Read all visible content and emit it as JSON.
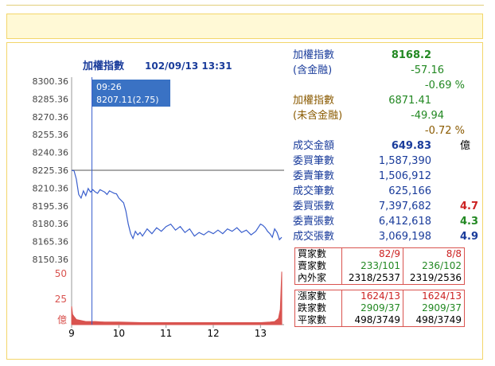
{
  "chart_header": {
    "title": "加權指數",
    "datetime": "102/09/13 13:31"
  },
  "tooltip": {
    "time": "09:26",
    "value": "8207.11(2.75)"
  },
  "colors": {
    "line": "#3a5fcd",
    "volume": "#d9534f",
    "reference": "#aaaaaa",
    "up": "#cc2222",
    "down": "#228822",
    "blue_text": "#1a3c9b",
    "brown_text": "#8a5a00",
    "frame": "#f3d66a"
  },
  "chart_data": {
    "type": "line",
    "x_ticks": [
      "9",
      "10",
      "11",
      "12",
      "13"
    ],
    "y_ticks": [
      "8300.36",
      "8285.36",
      "8270.36",
      "8255.36",
      "8240.36",
      "8225.36",
      "8210.36",
      "8195.36",
      "8180.36",
      "8165.36",
      "8150.36"
    ],
    "ylim": [
      8150.36,
      8300.36
    ],
    "reference_value": 8225.36,
    "tooltip_x": 9.43,
    "series": [
      {
        "x": [
          9.0,
          9.05,
          9.1,
          9.15,
          9.2,
          9.25,
          9.3,
          9.35,
          9.4,
          9.45,
          9.5,
          9.55,
          9.6,
          9.65,
          9.7,
          9.75,
          9.8,
          9.85,
          9.9,
          9.95,
          10.0,
          10.05,
          10.1,
          10.15,
          10.2,
          10.25,
          10.3,
          10.35,
          10.4,
          10.45,
          10.5,
          10.6,
          10.7,
          10.8,
          10.9,
          11.0,
          11.1,
          11.2,
          11.3,
          11.4,
          11.5,
          11.6,
          11.7,
          11.8,
          11.9,
          12.0,
          12.1,
          12.2,
          12.3,
          12.4,
          12.5,
          12.6,
          12.7,
          12.8,
          12.9,
          13.0,
          13.05,
          13.1,
          13.15,
          13.2,
          13.25,
          13.3,
          13.35,
          13.4,
          13.45
        ],
        "values": [
          8225.2,
          8225.0,
          8218.0,
          8205.0,
          8202.0,
          8208.0,
          8204.0,
          8210.0,
          8207.0,
          8209.0,
          8207.1,
          8206.0,
          8209.0,
          8208.0,
          8207.0,
          8205.0,
          8208.0,
          8207.0,
          8206.0,
          8205.5,
          8202.0,
          8200.0,
          8198.0,
          8191.0,
          8180.0,
          8172.0,
          8168.0,
          8174.0,
          8171.0,
          8173.0,
          8170.0,
          8176.0,
          8172.0,
          8177.0,
          8174.0,
          8178.0,
          8180.0,
          8175.0,
          8178.0,
          8173.0,
          8176.0,
          8170.0,
          8173.0,
          8171.0,
          8174.0,
          8172.0,
          8175.0,
          8172.0,
          8176.0,
          8174.0,
          8177.0,
          8173.0,
          8175.0,
          8171.0,
          8174.0,
          8180.0,
          8179.0,
          8177.0,
          8174.0,
          8172.0,
          8169.0,
          8176.0,
          8173.0,
          8167.0,
          8169.0
        ]
      }
    ],
    "volume": {
      "y_ticks": [
        "50",
        "25",
        "億"
      ],
      "ylim": [
        0,
        50
      ],
      "x": [
        9.0,
        9.02,
        9.05,
        9.1,
        9.2,
        9.3,
        9.5,
        9.7,
        10.0,
        10.5,
        11.0,
        11.5,
        12.0,
        12.5,
        13.0,
        13.2,
        13.3,
        13.38,
        13.42,
        13.45
      ],
      "values": [
        18,
        10,
        8,
        5,
        4,
        3,
        3,
        2.5,
        2.5,
        2,
        2,
        2,
        2,
        2,
        2,
        2.5,
        3,
        6,
        15,
        52
      ]
    }
  },
  "stats": [
    {
      "label": "加權指數",
      "value": "8168.2",
      "label_color": "#1a3c9b",
      "value_color": "#228822",
      "bold": true
    },
    {
      "label": "(含金融)",
      "value": "-57.16",
      "label_color": "#1a3c9b",
      "value_color": "#228822"
    },
    {
      "label": "",
      "value": "-0.69 %",
      "label_color": "#1a3c9b",
      "value_color": "#228822"
    },
    {
      "label": "加權指數",
      "value": "6871.41",
      "label_color": "#8a5a00",
      "value_color": "#228822"
    },
    {
      "label": "(未含金融)",
      "value": "-49.94",
      "label_color": "#8a5a00",
      "value_color": "#228822"
    },
    {
      "label": "",
      "value": "-0.72 %",
      "label_color": "#8a5a00",
      "value_color": "#8a5a00"
    },
    {
      "label": "成交金額",
      "value": "649.83",
      "unit": "億",
      "label_color": "#1a3c9b",
      "value_color": "#1a3c9b",
      "bold": true
    },
    {
      "label": "委買筆數",
      "value": "1,587,390",
      "label_color": "#1a3c9b",
      "value_color": "#1a3c9b"
    },
    {
      "label": "委賣筆數",
      "value": "1,506,912",
      "label_color": "#1a3c9b",
      "value_color": "#1a3c9b"
    },
    {
      "label": "成交筆數",
      "value": "625,166",
      "label_color": "#1a3c9b",
      "value_color": "#1a3c9b"
    },
    {
      "label": "委買張數",
      "value": "7,397,682",
      "extra": "4.7",
      "extra_color": "#cc2222",
      "label_color": "#1a3c9b",
      "value_color": "#1a3c9b"
    },
    {
      "label": "委賣張數",
      "value": "6,412,618",
      "extra": "4.3",
      "extra_color": "#228822",
      "label_color": "#1a3c9b",
      "value_color": "#1a3c9b"
    },
    {
      "label": "成交張數",
      "value": "3,069,198",
      "extra": "4.9",
      "extra_color": "#1a3c9b",
      "label_color": "#1a3c9b",
      "value_color": "#1a3c9b"
    }
  ],
  "table1": [
    {
      "label": "買家數",
      "a": "82/9",
      "b": "8/8",
      "color": "#cc2222"
    },
    {
      "label": "賣家數",
      "a": "233/101",
      "b": "236/102",
      "color": "#228822"
    },
    {
      "label": "內外家",
      "a": "2318/2537",
      "b": "2319/2536",
      "color": "#000000"
    }
  ],
  "table2": [
    {
      "label": "漲家數",
      "a": "1624/13",
      "b": "1624/13",
      "color": "#cc2222"
    },
    {
      "label": "跌家數",
      "a": "2909/37",
      "b": "2909/37",
      "color": "#228822"
    },
    {
      "label": "平家數",
      "a": "498/3749",
      "b": "498/3749",
      "color": "#000000"
    }
  ]
}
